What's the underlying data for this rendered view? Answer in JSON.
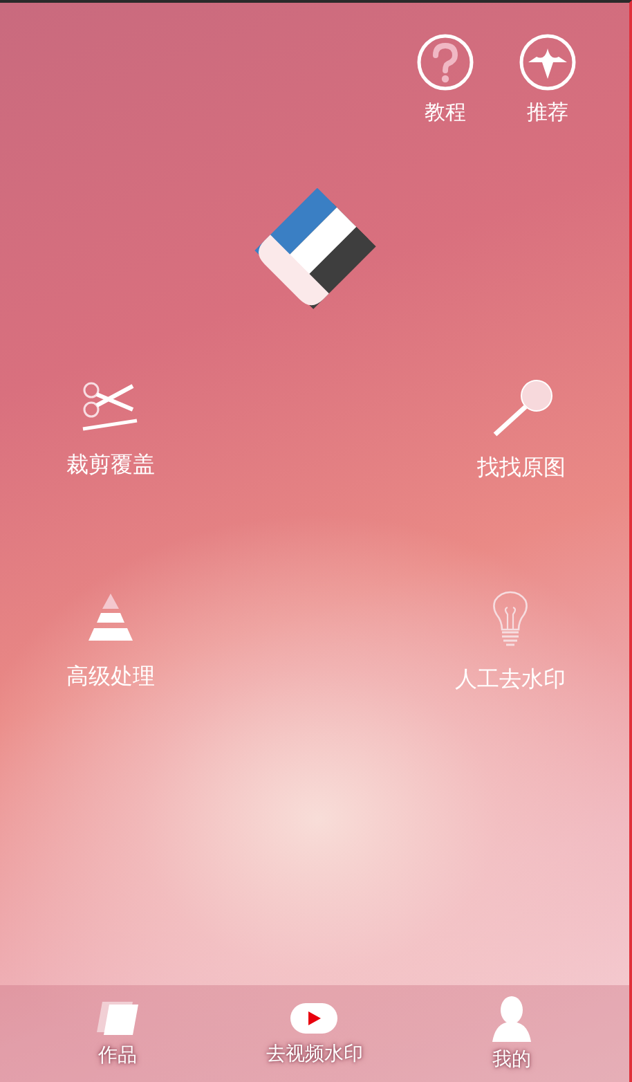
{
  "top_actions": [
    {
      "label": "教程"
    },
    {
      "label": "推荐"
    }
  ],
  "features": [
    {
      "label": "裁剪覆盖"
    },
    {
      "label": "找找原图"
    },
    {
      "label": "高级处理"
    },
    {
      "label": "人工去水印"
    }
  ],
  "bottom_nav": [
    {
      "label": "作品"
    },
    {
      "label": "去视频水印"
    },
    {
      "label": "我的"
    }
  ]
}
